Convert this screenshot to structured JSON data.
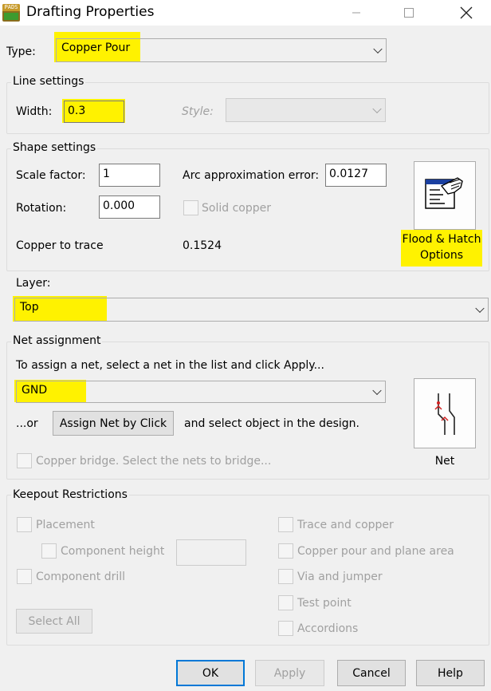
{
  "window": {
    "title": "Drafting Properties",
    "app_icon_text": "PADS"
  },
  "type": {
    "label": "Type:",
    "value": "Copper Pour"
  },
  "line_settings": {
    "group_label": "Line settings",
    "width_label": "Width:",
    "width_value": "0.3",
    "style_label": "Style:",
    "style_value": ""
  },
  "shape_settings": {
    "group_label": "Shape settings",
    "scale_label": "Scale factor:",
    "scale_value": "1",
    "arc_label": "Arc approximation error:",
    "arc_value": "0.0127",
    "rotation_label": "Rotation:",
    "rotation_value": "0.000",
    "solid_copper_label": "Solid copper",
    "copper_trace_label": "Copper to trace",
    "copper_trace_value": "0.1524",
    "flood_button_line1": "Flood & Hatch",
    "flood_button_line2": "Options"
  },
  "layer": {
    "label": "Layer:",
    "value": "Top"
  },
  "net_assignment": {
    "group_label": "Net assignment",
    "instruction": "To assign a net, select a net in the list and click Apply...",
    "net_value": "GND",
    "or_label": "...or",
    "assign_button": "Assign Net by Click",
    "after_text": "and select object in the design.",
    "bridge_label": "Copper bridge. Select the nets to bridge...",
    "net_button_label": "Net"
  },
  "keepout": {
    "group_label": "Keepout Restrictions",
    "placement": "Placement",
    "component_height": "Component height",
    "component_height_value": "",
    "component_drill": "Component drill",
    "select_all": "Select All",
    "trace_copper": "Trace and copper",
    "copper_pour_plane": "Copper pour and plane area",
    "via_jumper": "Via and jumper",
    "test_point": "Test point",
    "accordions": "Accordions"
  },
  "footer": {
    "ok": "OK",
    "apply": "Apply",
    "cancel": "Cancel",
    "help": "Help"
  },
  "colors": {
    "highlight": "#fff200",
    "focus_border": "#0078d7",
    "background": "#f0f0f0"
  }
}
